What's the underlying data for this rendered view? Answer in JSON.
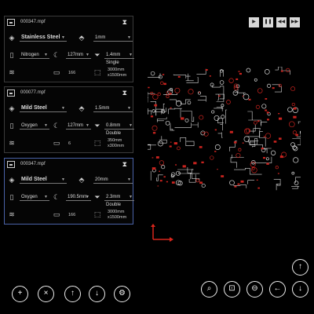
{
  "player": {
    "icons": [
      "play-icon",
      "pause-icon",
      "step-back-icon",
      "step-forward-icon"
    ],
    "glyphs": [
      "▶",
      "❚❚",
      "◀◀",
      "▶▶"
    ]
  },
  "jobs": [
    {
      "file": "000347.mpf",
      "material": "Stainless Steel",
      "thickness": "1mm",
      "gas": "Nitrogen",
      "focus": "127mm",
      "nozzle": "1.4mm Single",
      "count": "166",
      "sheet_w": "3000mm",
      "sheet_h": "x1500mm",
      "selected": false
    },
    {
      "file": "000077.mpf",
      "material": "Mild Steel",
      "thickness": "1.5mm",
      "gas": "Oxygen",
      "focus": "127mm",
      "nozzle": "0.8mm Double",
      "count": "6",
      "sheet_w": "350mm",
      "sheet_h": "x300mm",
      "selected": false
    },
    {
      "file": "000347.mpf",
      "material": "Mild Steel",
      "thickness": "20mm",
      "gas": "Oxygen",
      "focus": "190.5mm",
      "nozzle": "2.3mm Double",
      "count": "166",
      "sheet_w": "3000mm",
      "sheet_h": "x1500mm",
      "selected": true
    }
  ],
  "bottom_left": {
    "icons": [
      "add-icon",
      "remove-icon",
      "move-up-icon",
      "move-down-icon",
      "settings-icon"
    ],
    "glyphs": [
      "+",
      "×",
      "↑",
      "↓",
      "⚙"
    ]
  },
  "bottom_right": {
    "icons": [
      "zoom-in-icon",
      "zoom-fit-icon",
      "zoom-out-icon",
      "pan-left-icon",
      "pan-down-icon"
    ],
    "glyphs": [
      "⌕",
      "⊡",
      "⊖",
      "←",
      "↓"
    ]
  },
  "scroll_up": {
    "icon": "scroll-up-icon",
    "glyph": "↑"
  },
  "colors": {
    "accent_selected": "#4a62a8",
    "board_lines": "#d8d8d8",
    "part_marks": "#c8231e",
    "axis": "#d9261c"
  }
}
